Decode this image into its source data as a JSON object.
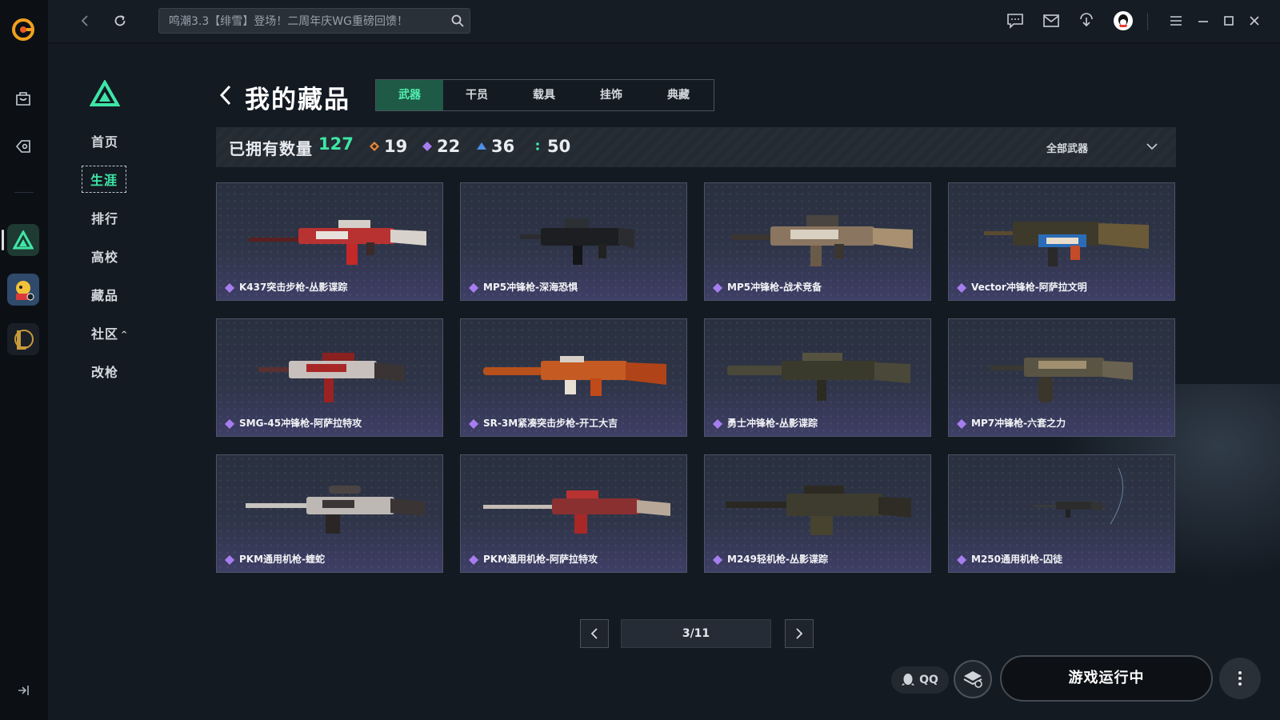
{
  "topbar": {
    "search_placeholder": "鸣潮3.3【绯雪】登场！二周年庆WG重磅回馈！"
  },
  "sidenav": {
    "items": [
      {
        "label": "首页"
      },
      {
        "label": "生涯",
        "active": true
      },
      {
        "label": "排行"
      },
      {
        "label": "高校"
      },
      {
        "label": "藏品"
      },
      {
        "label": "社区"
      },
      {
        "label": "改枪"
      }
    ]
  },
  "header": {
    "title": "我的藏品",
    "tabs": [
      "武器",
      "干员",
      "载具",
      "挂饰",
      "典藏"
    ],
    "active_tab": "武器"
  },
  "stats": {
    "owned_label": "已拥有数量",
    "owned_total": "127",
    "rarity_counts": [
      {
        "color": "#e8893a",
        "count": "19"
      },
      {
        "color": "#a77ef0",
        "count": "22"
      },
      {
        "color": "#4f8fe8",
        "count": "36"
      },
      {
        "color": "#3ee6a6",
        "count": "50"
      }
    ],
    "filter_label": "全部武器"
  },
  "items": [
    {
      "name": "K437突击步枪-丛影谍踪",
      "rarity_color": "#a77ef0",
      "icon": "assault-rifle-icon"
    },
    {
      "name": "MP5冲锋枪-深海恐惧",
      "rarity_color": "#a77ef0",
      "icon": "smg-icon"
    },
    {
      "name": "MP5冲锋枪-战术竞备",
      "rarity_color": "#a77ef0",
      "icon": "smg-icon"
    },
    {
      "name": "Vector冲锋枪-阿萨拉文明",
      "rarity_color": "#a77ef0",
      "icon": "smg-icon"
    },
    {
      "name": "SMG-45冲锋枪-阿萨拉特攻",
      "rarity_color": "#a77ef0",
      "icon": "smg-icon"
    },
    {
      "name": "SR-3M紧凑突击步枪-开工大吉",
      "rarity_color": "#a77ef0",
      "icon": "assault-rifle-icon"
    },
    {
      "name": "勇士冲锋枪-丛影谍踪",
      "rarity_color": "#a77ef0",
      "icon": "smg-icon"
    },
    {
      "name": "MP7冲锋枪-六套之力",
      "rarity_color": "#a77ef0",
      "icon": "smg-icon"
    },
    {
      "name": "PKM通用机枪-蝰蛇",
      "rarity_color": "#a77ef0",
      "icon": "machine-gun-icon"
    },
    {
      "name": "PKM通用机枪-阿萨拉特攻",
      "rarity_color": "#a77ef0",
      "icon": "machine-gun-icon"
    },
    {
      "name": "M249轻机枪-丛影谍踪",
      "rarity_color": "#a77ef0",
      "icon": "machine-gun-icon"
    },
    {
      "name": "M250通用机枪-囚徒",
      "rarity_color": "#a77ef0",
      "icon": "machine-gun-icon"
    }
  ],
  "pagination": {
    "label": "3/11"
  },
  "bottom": {
    "qq_label": "QQ",
    "play_label": "游戏运行中"
  },
  "colors": {
    "accent": "#3ee6a6",
    "tab_active_bg": "#1e5a45"
  }
}
